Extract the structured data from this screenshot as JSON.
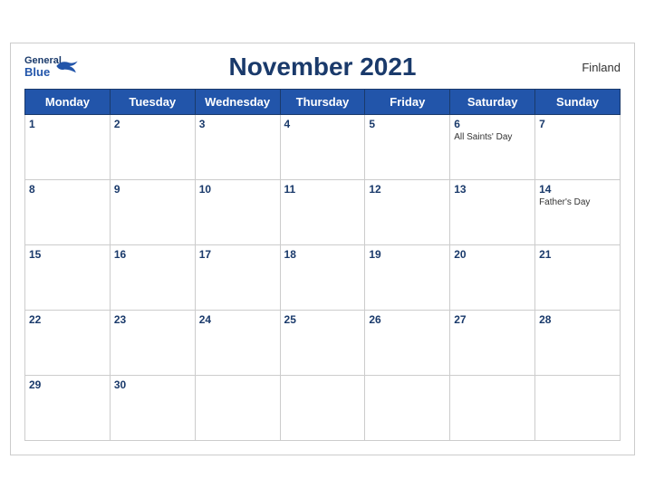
{
  "header": {
    "title": "November 2021",
    "country": "Finland",
    "logo_general": "General",
    "logo_blue": "Blue"
  },
  "weekdays": [
    "Monday",
    "Tuesday",
    "Wednesday",
    "Thursday",
    "Friday",
    "Saturday",
    "Sunday"
  ],
  "weeks": [
    [
      {
        "day": "1",
        "holiday": ""
      },
      {
        "day": "2",
        "holiday": ""
      },
      {
        "day": "3",
        "holiday": ""
      },
      {
        "day": "4",
        "holiday": ""
      },
      {
        "day": "5",
        "holiday": ""
      },
      {
        "day": "6",
        "holiday": "All Saints' Day"
      },
      {
        "day": "7",
        "holiday": ""
      }
    ],
    [
      {
        "day": "8",
        "holiday": ""
      },
      {
        "day": "9",
        "holiday": ""
      },
      {
        "day": "10",
        "holiday": ""
      },
      {
        "day": "11",
        "holiday": ""
      },
      {
        "day": "12",
        "holiday": ""
      },
      {
        "day": "13",
        "holiday": ""
      },
      {
        "day": "14",
        "holiday": "Father's Day"
      }
    ],
    [
      {
        "day": "15",
        "holiday": ""
      },
      {
        "day": "16",
        "holiday": ""
      },
      {
        "day": "17",
        "holiday": ""
      },
      {
        "day": "18",
        "holiday": ""
      },
      {
        "day": "19",
        "holiday": ""
      },
      {
        "day": "20",
        "holiday": ""
      },
      {
        "day": "21",
        "holiday": ""
      }
    ],
    [
      {
        "day": "22",
        "holiday": ""
      },
      {
        "day": "23",
        "holiday": ""
      },
      {
        "day": "24",
        "holiday": ""
      },
      {
        "day": "25",
        "holiday": ""
      },
      {
        "day": "26",
        "holiday": ""
      },
      {
        "day": "27",
        "holiday": ""
      },
      {
        "day": "28",
        "holiday": ""
      }
    ],
    [
      {
        "day": "29",
        "holiday": ""
      },
      {
        "day": "30",
        "holiday": ""
      },
      {
        "day": "",
        "holiday": ""
      },
      {
        "day": "",
        "holiday": ""
      },
      {
        "day": "",
        "holiday": ""
      },
      {
        "day": "",
        "holiday": ""
      },
      {
        "day": "",
        "holiday": ""
      }
    ]
  ]
}
